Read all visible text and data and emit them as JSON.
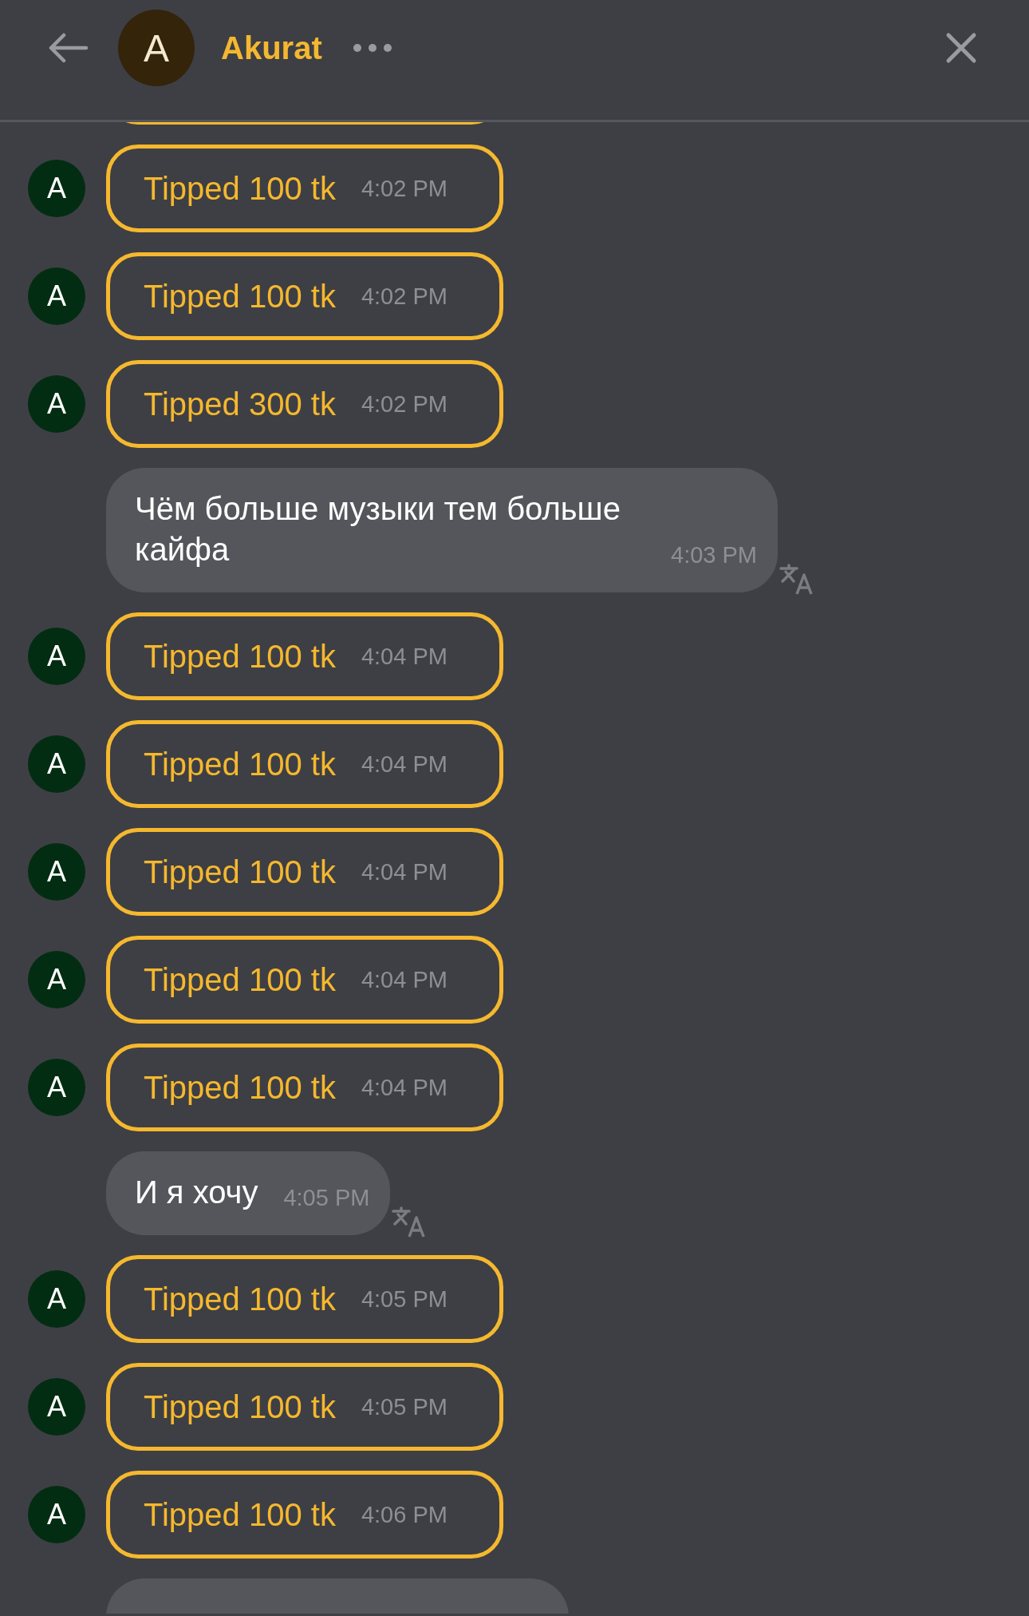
{
  "header": {
    "avatar_letter": "A",
    "name": "Akurat"
  },
  "messages": [
    {
      "kind": "tip",
      "avatar_letter": "A",
      "text": "Tipped 100 tk",
      "time": "4:02 PM"
    },
    {
      "kind": "tip",
      "avatar_letter": "A",
      "text": "Tipped 100 tk",
      "time": "4:02 PM"
    },
    {
      "kind": "tip",
      "avatar_letter": "A",
      "text": "Tipped 300 tk",
      "time": "4:02 PM"
    },
    {
      "kind": "text",
      "text": "Чём больше музыки тем больше кайфа",
      "time": "4:03 PM"
    },
    {
      "kind": "tip",
      "avatar_letter": "A",
      "text": "Tipped 100 tk",
      "time": "4:04 PM"
    },
    {
      "kind": "tip",
      "avatar_letter": "A",
      "text": "Tipped 100 tk",
      "time": "4:04 PM"
    },
    {
      "kind": "tip",
      "avatar_letter": "A",
      "text": "Tipped 100 tk",
      "time": "4:04 PM"
    },
    {
      "kind": "tip",
      "avatar_letter": "A",
      "text": "Tipped 100 tk",
      "time": "4:04 PM"
    },
    {
      "kind": "tip",
      "avatar_letter": "A",
      "text": "Tipped 100 tk",
      "time": "4:04 PM"
    },
    {
      "kind": "text",
      "text": "И я хочу",
      "time": "4:05 PM"
    },
    {
      "kind": "tip",
      "avatar_letter": "A",
      "text": "Tipped 100 tk",
      "time": "4:05 PM"
    },
    {
      "kind": "tip",
      "avatar_letter": "A",
      "text": "Tipped 100 tk",
      "time": "4:05 PM"
    },
    {
      "kind": "tip",
      "avatar_letter": "A",
      "text": "Tipped 100 tk",
      "time": "4:06 PM"
    }
  ]
}
